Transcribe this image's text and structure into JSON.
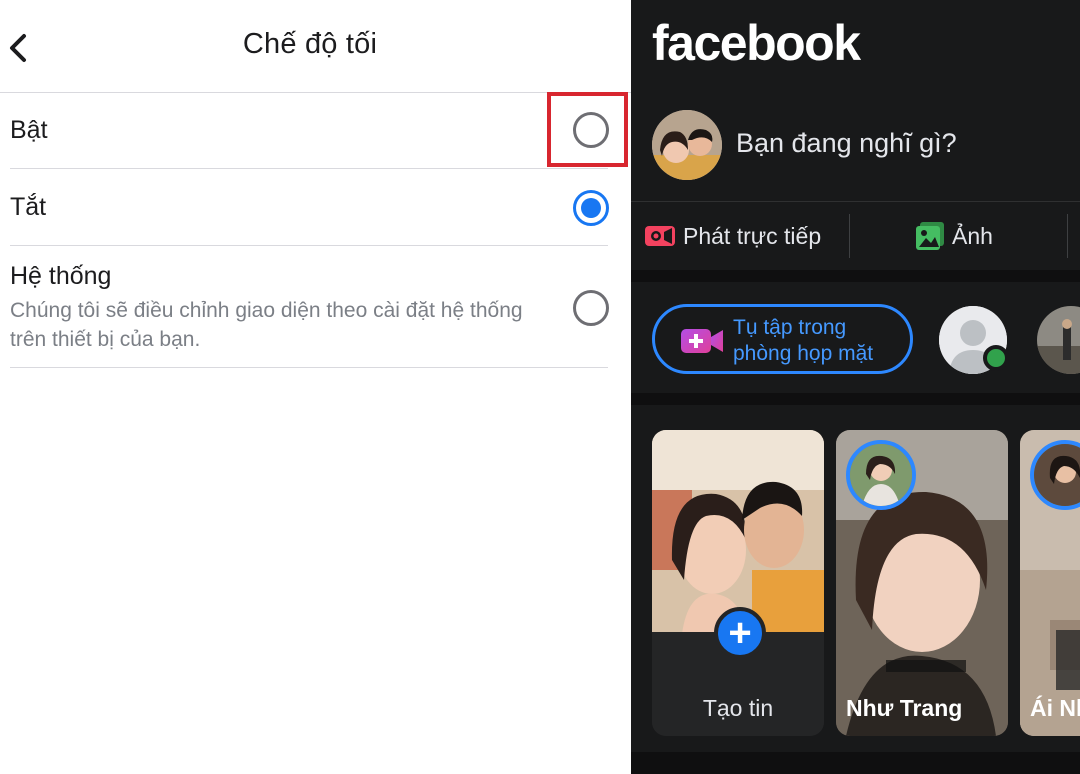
{
  "settings": {
    "title": "Chế độ tối",
    "options": [
      {
        "label": "Bật",
        "selected": false
      },
      {
        "label": "Tắt",
        "selected": true
      },
      {
        "label": "Hệ thống",
        "selected": false,
        "description": "Chúng tôi sẽ điều chỉnh giao diện theo cài đặt hệ thống trên thiết bị của bạn."
      }
    ],
    "highlight_color": "#d8262f",
    "accent": "#1877f2"
  },
  "feed": {
    "logo": "facebook",
    "composer_placeholder": "Bạn đang nghĩ gì?",
    "actions": [
      {
        "label": "Phát trực tiếp",
        "icon": "live-video-icon",
        "color": "#f3425f"
      },
      {
        "label": "Ảnh",
        "icon": "photo-icon",
        "color": "#45bd62"
      }
    ],
    "room_button": {
      "line1": "Tụ tập trong",
      "line2": "phòng họp mặt",
      "icon": "room-video-icon"
    },
    "stories": [
      {
        "label": "Tạo tin",
        "type": "create"
      },
      {
        "name": "Như Trang"
      },
      {
        "name": "Ái Nh"
      }
    ],
    "background": "#18191a"
  }
}
